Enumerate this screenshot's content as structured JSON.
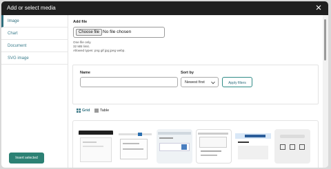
{
  "dialog": {
    "title": "Add or select media"
  },
  "sidebar": {
    "tabs": [
      {
        "label": "Image"
      },
      {
        "label": "Chart"
      },
      {
        "label": "Document"
      },
      {
        "label": "SVG image"
      }
    ]
  },
  "upload": {
    "label": "Add file",
    "button": "Choose file",
    "file_status": "No file chosen",
    "hint_count": "One file only.",
    "hint_size": "32 MB limit.",
    "hint_types": "Allowed types: png gif jpg jpeg webp."
  },
  "filters": {
    "name_label": "Name",
    "sort_label": "Sort by",
    "sort_value": "Newest first",
    "apply": "Apply filters"
  },
  "view": {
    "grid": "Grid",
    "table": "Table"
  },
  "footer": {
    "insert": "Insert selected"
  },
  "colors": {
    "accent": "#2f6f7e",
    "titlebar": "#1f1f1f",
    "primary_button": "#2c8174"
  }
}
